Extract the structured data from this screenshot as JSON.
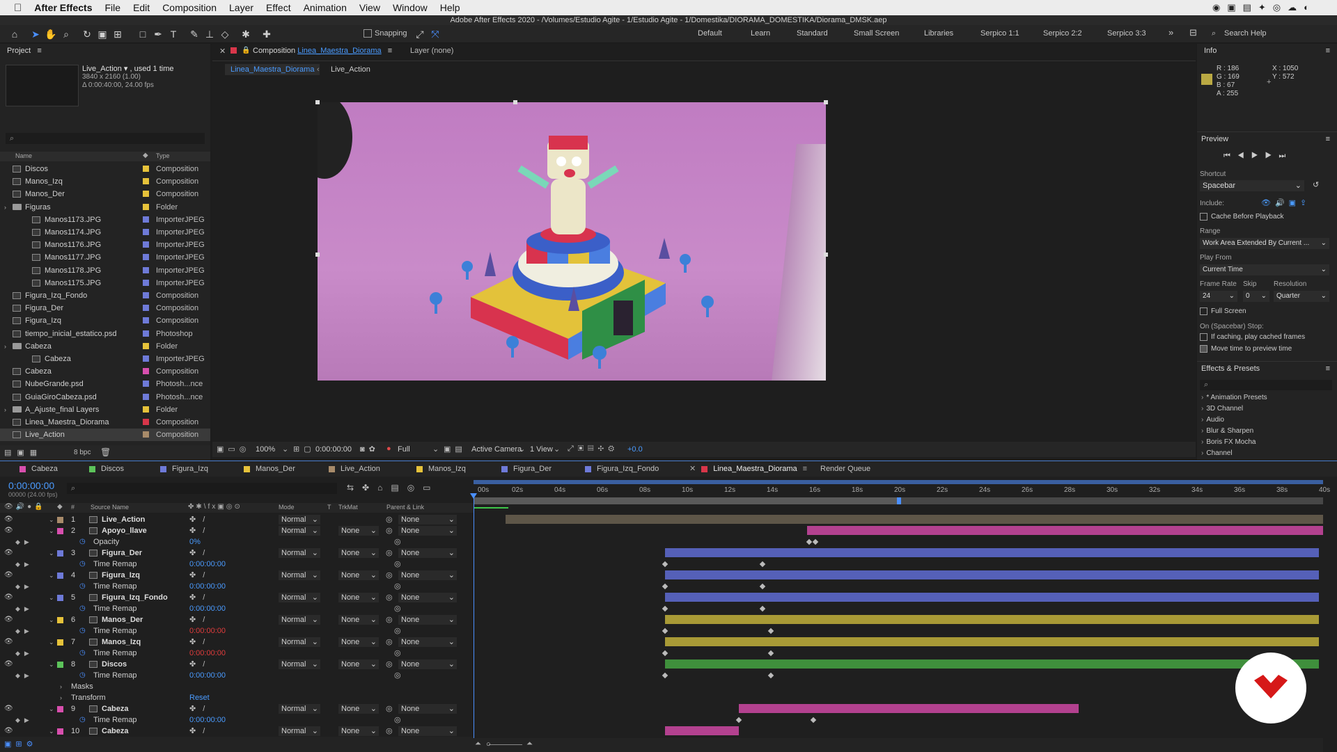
{
  "menubar": {
    "app": "After Effects",
    "items": [
      "File",
      "Edit",
      "Composition",
      "Layer",
      "Effect",
      "Animation",
      "View",
      "Window",
      "Help"
    ]
  },
  "window_title": "Adobe After Effects 2020 - /Volumes/Estudio Agite - 1/Estudio Agite - 1/Domestika/DIORAMA_DOMESTIKA/Diorama_DMSK.aep",
  "toolbar": {
    "snapping": "Snapping",
    "workspaces": [
      "Default",
      "Learn",
      "Standard",
      "Small Screen",
      "Libraries",
      "Serpico 1:1",
      "Serpico 2:2",
      "Serpico 3:3"
    ],
    "search": "Search Help"
  },
  "project": {
    "title": "Project",
    "selected_name": "Live_Action ▾ , used 1 time",
    "selected_info1": "3840 x 2160 (1.00)",
    "selected_info2": "Δ 0:00:40:00, 24.00 fps",
    "col_name": "Name",
    "col_type": "Type",
    "bpc": "8 bpc",
    "items": [
      {
        "name": "Discos",
        "type": "Composition",
        "color": "#e6c23a",
        "kind": "comp",
        "indent": 0
      },
      {
        "name": "Manos_Izq",
        "type": "Composition",
        "color": "#e6c23a",
        "kind": "comp",
        "indent": 0
      },
      {
        "name": "Manos_Der",
        "type": "Composition",
        "color": "#e6c23a",
        "kind": "comp",
        "indent": 0
      },
      {
        "name": "Figuras",
        "type": "Folder",
        "color": "#e6c23a",
        "kind": "folder",
        "indent": 0
      },
      {
        "name": "Manos1173.JPG",
        "type": "ImporterJPEG",
        "color": "#6e7ad8",
        "kind": "file",
        "indent": 2
      },
      {
        "name": "Manos1174.JPG",
        "type": "ImporterJPEG",
        "color": "#6e7ad8",
        "kind": "file",
        "indent": 2
      },
      {
        "name": "Manos1176.JPG",
        "type": "ImporterJPEG",
        "color": "#6e7ad8",
        "kind": "file",
        "indent": 2
      },
      {
        "name": "Manos1177.JPG",
        "type": "ImporterJPEG",
        "color": "#6e7ad8",
        "kind": "file",
        "indent": 2
      },
      {
        "name": "Manos1178.JPG",
        "type": "ImporterJPEG",
        "color": "#6e7ad8",
        "kind": "file",
        "indent": 2
      },
      {
        "name": "Manos1175.JPG",
        "type": "ImporterJPEG",
        "color": "#6e7ad8",
        "kind": "file",
        "indent": 2
      },
      {
        "name": "Figura_Izq_Fondo",
        "type": "Composition",
        "color": "#6e7ad8",
        "kind": "comp",
        "indent": 0
      },
      {
        "name": "Figura_Der",
        "type": "Composition",
        "color": "#6e7ad8",
        "kind": "comp",
        "indent": 0
      },
      {
        "name": "Figura_Izq",
        "type": "Composition",
        "color": "#6e7ad8",
        "kind": "comp",
        "indent": 0
      },
      {
        "name": "tiempo_inicial_estatico.psd",
        "type": "Photoshop",
        "color": "#6e7ad8",
        "kind": "file",
        "indent": 0
      },
      {
        "name": "Cabeza",
        "type": "Folder",
        "color": "#e6c23a",
        "kind": "folder",
        "indent": 0
      },
      {
        "name": "Cabeza",
        "type": "ImporterJPEG",
        "color": "#6e7ad8",
        "kind": "file",
        "indent": 2
      },
      {
        "name": "Cabeza",
        "type": "Composition",
        "color": "#d84fae",
        "kind": "comp",
        "indent": 0
      },
      {
        "name": "NubeGrande.psd",
        "type": "Photosh...nce",
        "color": "#6e7ad8",
        "kind": "file",
        "indent": 0
      },
      {
        "name": "GuiaGiroCabeza.psd",
        "type": "Photosh...nce",
        "color": "#6e7ad8",
        "kind": "file",
        "indent": 0
      },
      {
        "name": "A_Ajuste_final Layers",
        "type": "Folder",
        "color": "#e6c23a",
        "kind": "folder",
        "indent": 0
      },
      {
        "name": "Linea_Maestra_Diorama",
        "type": "Composition",
        "color": "#d8364a",
        "kind": "comp",
        "indent": 0
      },
      {
        "name": "Live_Action",
        "type": "Composition",
        "color": "#a88b6a",
        "kind": "comp",
        "indent": 0
      }
    ]
  },
  "composition": {
    "tab_label": "Composition",
    "tab_comp": "Linea_Maestra_Diorama",
    "layer_tab": "Layer (none)",
    "crumb1": "Linea_Maestra_Diorama",
    "crumb2": "Live_Action",
    "zoom": "100%",
    "timecode": "0:00:00:00",
    "resolution": "Full",
    "camera": "Active Camera",
    "views": "1 View",
    "exposure": "+0.0"
  },
  "info": {
    "title": "Info",
    "r": "R : 186",
    "g": "G : 169",
    "b": "B : 67",
    "a": "A : 255",
    "x": "X : 1050",
    "y": "Y : 572",
    "swatch": "#baa943"
  },
  "preview": {
    "title": "Preview",
    "shortcut_label": "Shortcut",
    "shortcut": "Spacebar",
    "include": "Include:",
    "cache": "Cache Before Playback",
    "range_label": "Range",
    "range": "Work Area Extended By Current ...",
    "playfrom_label": "Play From",
    "playfrom": "Current Time",
    "framerate_label": "Frame Rate",
    "skip_label": "Skip",
    "resolution_label": "Resolution",
    "framerate": "24",
    "skip": "0",
    "resolution": "Quarter",
    "fullscreen": "Full Screen",
    "stop_label": "On (Spacebar) Stop:",
    "opt1": "If caching, play cached frames",
    "opt2": "Move time to preview time"
  },
  "effects": {
    "title": "Effects & Presets",
    "items": [
      "* Animation Presets",
      "3D Channel",
      "Audio",
      "Blur & Sharpen",
      "Boris FX Mocha",
      "Channel"
    ]
  },
  "timeline": {
    "tabs": [
      {
        "label": "Cabeza",
        "color": "#d84fae"
      },
      {
        "label": "Discos",
        "color": "#5cc35a"
      },
      {
        "label": "Figura_Izq",
        "color": "#6e7ad8"
      },
      {
        "label": "Manos_Der",
        "color": "#e6c23a"
      },
      {
        "label": "Live_Action",
        "color": "#a88b6a"
      },
      {
        "label": "Manos_Izq",
        "color": "#e6c23a"
      },
      {
        "label": "Figura_Der",
        "color": "#6e7ad8"
      },
      {
        "label": "Figura_Izq_Fondo",
        "color": "#6e7ad8"
      },
      {
        "label": "Linea_Maestra_Diorama",
        "color": "#d8364a"
      },
      {
        "label": "Render Queue",
        "color": ""
      }
    ],
    "timecode": "0:00:00:00",
    "fps": "00000 (24.00 fps)",
    "col_source": "Source Name",
    "col_mode": "Mode",
    "col_t": "T",
    "col_trkmat": "TrkMat",
    "col_parent": "Parent & Link",
    "ruler": [
      "00s",
      "02s",
      "04s",
      "06s",
      "08s",
      "10s",
      "12s",
      "14s",
      "16s",
      "18s",
      "20s",
      "22s",
      "24s",
      "26s",
      "28s",
      "30s",
      "32s",
      "34s",
      "36s",
      "38s",
      "40s"
    ],
    "rows": [
      {
        "type": "layer",
        "num": "1",
        "name": "Live_Action",
        "color": "#a88b6a",
        "mode": "Normal",
        "trkmat": "",
        "parent": "None",
        "bar": {
          "start": 1.5,
          "end": 40,
          "color": "#5e5648"
        }
      },
      {
        "type": "layer",
        "num": "2",
        "name": "Apoyo_llave",
        "color": "#d84fae",
        "mode": "Normal",
        "trkmat": "None",
        "parent": "None",
        "bar": {
          "start": 15.7,
          "end": 40,
          "color": "#b3418f"
        }
      },
      {
        "type": "prop",
        "name": "Opacity",
        "value": "0%",
        "kfs": [
          15.8,
          16.1
        ]
      },
      {
        "type": "layer",
        "num": "3",
        "name": "Figura_Der",
        "color": "#6e7ad8",
        "mode": "Normal",
        "trkmat": "None",
        "parent": "None",
        "bar": {
          "start": 9,
          "end": 39.8,
          "color": "#5560b8"
        }
      },
      {
        "type": "prop",
        "name": "Time Remap",
        "value": "0:00:00:00",
        "kfs": [
          9,
          13.6
        ]
      },
      {
        "type": "layer",
        "num": "4",
        "name": "Figura_Izq",
        "color": "#6e7ad8",
        "mode": "Normal",
        "trkmat": "None",
        "parent": "None",
        "bar": {
          "start": 9,
          "end": 39.8,
          "color": "#5560b8"
        }
      },
      {
        "type": "prop",
        "name": "Time Remap",
        "value": "0:00:00:00",
        "kfs": [
          9,
          13.6
        ]
      },
      {
        "type": "layer",
        "num": "5",
        "name": "Figura_Izq_Fondo",
        "color": "#6e7ad8",
        "mode": "Normal",
        "trkmat": "None",
        "parent": "None",
        "bar": {
          "start": 9,
          "end": 39.8,
          "color": "#5560b8"
        }
      },
      {
        "type": "prop",
        "name": "Time Remap",
        "value": "0:00:00:00",
        "kfs": [
          9,
          13.6
        ]
      },
      {
        "type": "layer",
        "num": "6",
        "name": "Manos_Der",
        "color": "#e6c23a",
        "mode": "Normal",
        "trkmat": "None",
        "parent": "None",
        "bar": {
          "start": 9,
          "end": 39.8,
          "color": "#a89a36"
        }
      },
      {
        "type": "prop",
        "name": "Time Remap",
        "value": "0:00:00:00",
        "valueColor": "#e03c3c",
        "kfs": [
          9,
          14
        ]
      },
      {
        "type": "layer",
        "num": "7",
        "name": "Manos_Izq",
        "color": "#e6c23a",
        "mode": "Normal",
        "trkmat": "None",
        "parent": "None",
        "bar": {
          "start": 9,
          "end": 39.8,
          "color": "#a89a36"
        }
      },
      {
        "type": "prop",
        "name": "Time Remap",
        "value": "0:00:00:00",
        "valueColor": "#e03c3c",
        "kfs": [
          9,
          14
        ]
      },
      {
        "type": "layer",
        "num": "8",
        "name": "Discos",
        "color": "#5cc35a",
        "mode": "Normal",
        "trkmat": "None",
        "parent": "None",
        "bar": {
          "start": 9,
          "end": 39.8,
          "color": "#3f8f3c"
        }
      },
      {
        "type": "prop",
        "name": "Time Remap",
        "value": "0:00:00:00",
        "kfs": [
          9,
          14
        ]
      },
      {
        "type": "group",
        "name": "Masks",
        "value": ""
      },
      {
        "type": "group",
        "name": "Transform",
        "value": "Reset"
      },
      {
        "type": "layer",
        "num": "9",
        "name": "Cabeza",
        "color": "#d84fae",
        "mode": "Normal",
        "trkmat": "None",
        "parent": "None",
        "bar": {
          "start": 12.5,
          "end": 28.5,
          "color": "#b3418f"
        }
      },
      {
        "type": "prop",
        "name": "Time Remap",
        "value": "0:00:00:00",
        "kfs": [
          12.5,
          16
        ]
      },
      {
        "type": "layer",
        "num": "10",
        "name": "Cabeza",
        "color": "#d84fae",
        "mode": "Normal",
        "trkmat": "None",
        "parent": "None",
        "bar": {
          "start": 9,
          "end": 12.5,
          "color": "#b3418f"
        }
      }
    ]
  }
}
